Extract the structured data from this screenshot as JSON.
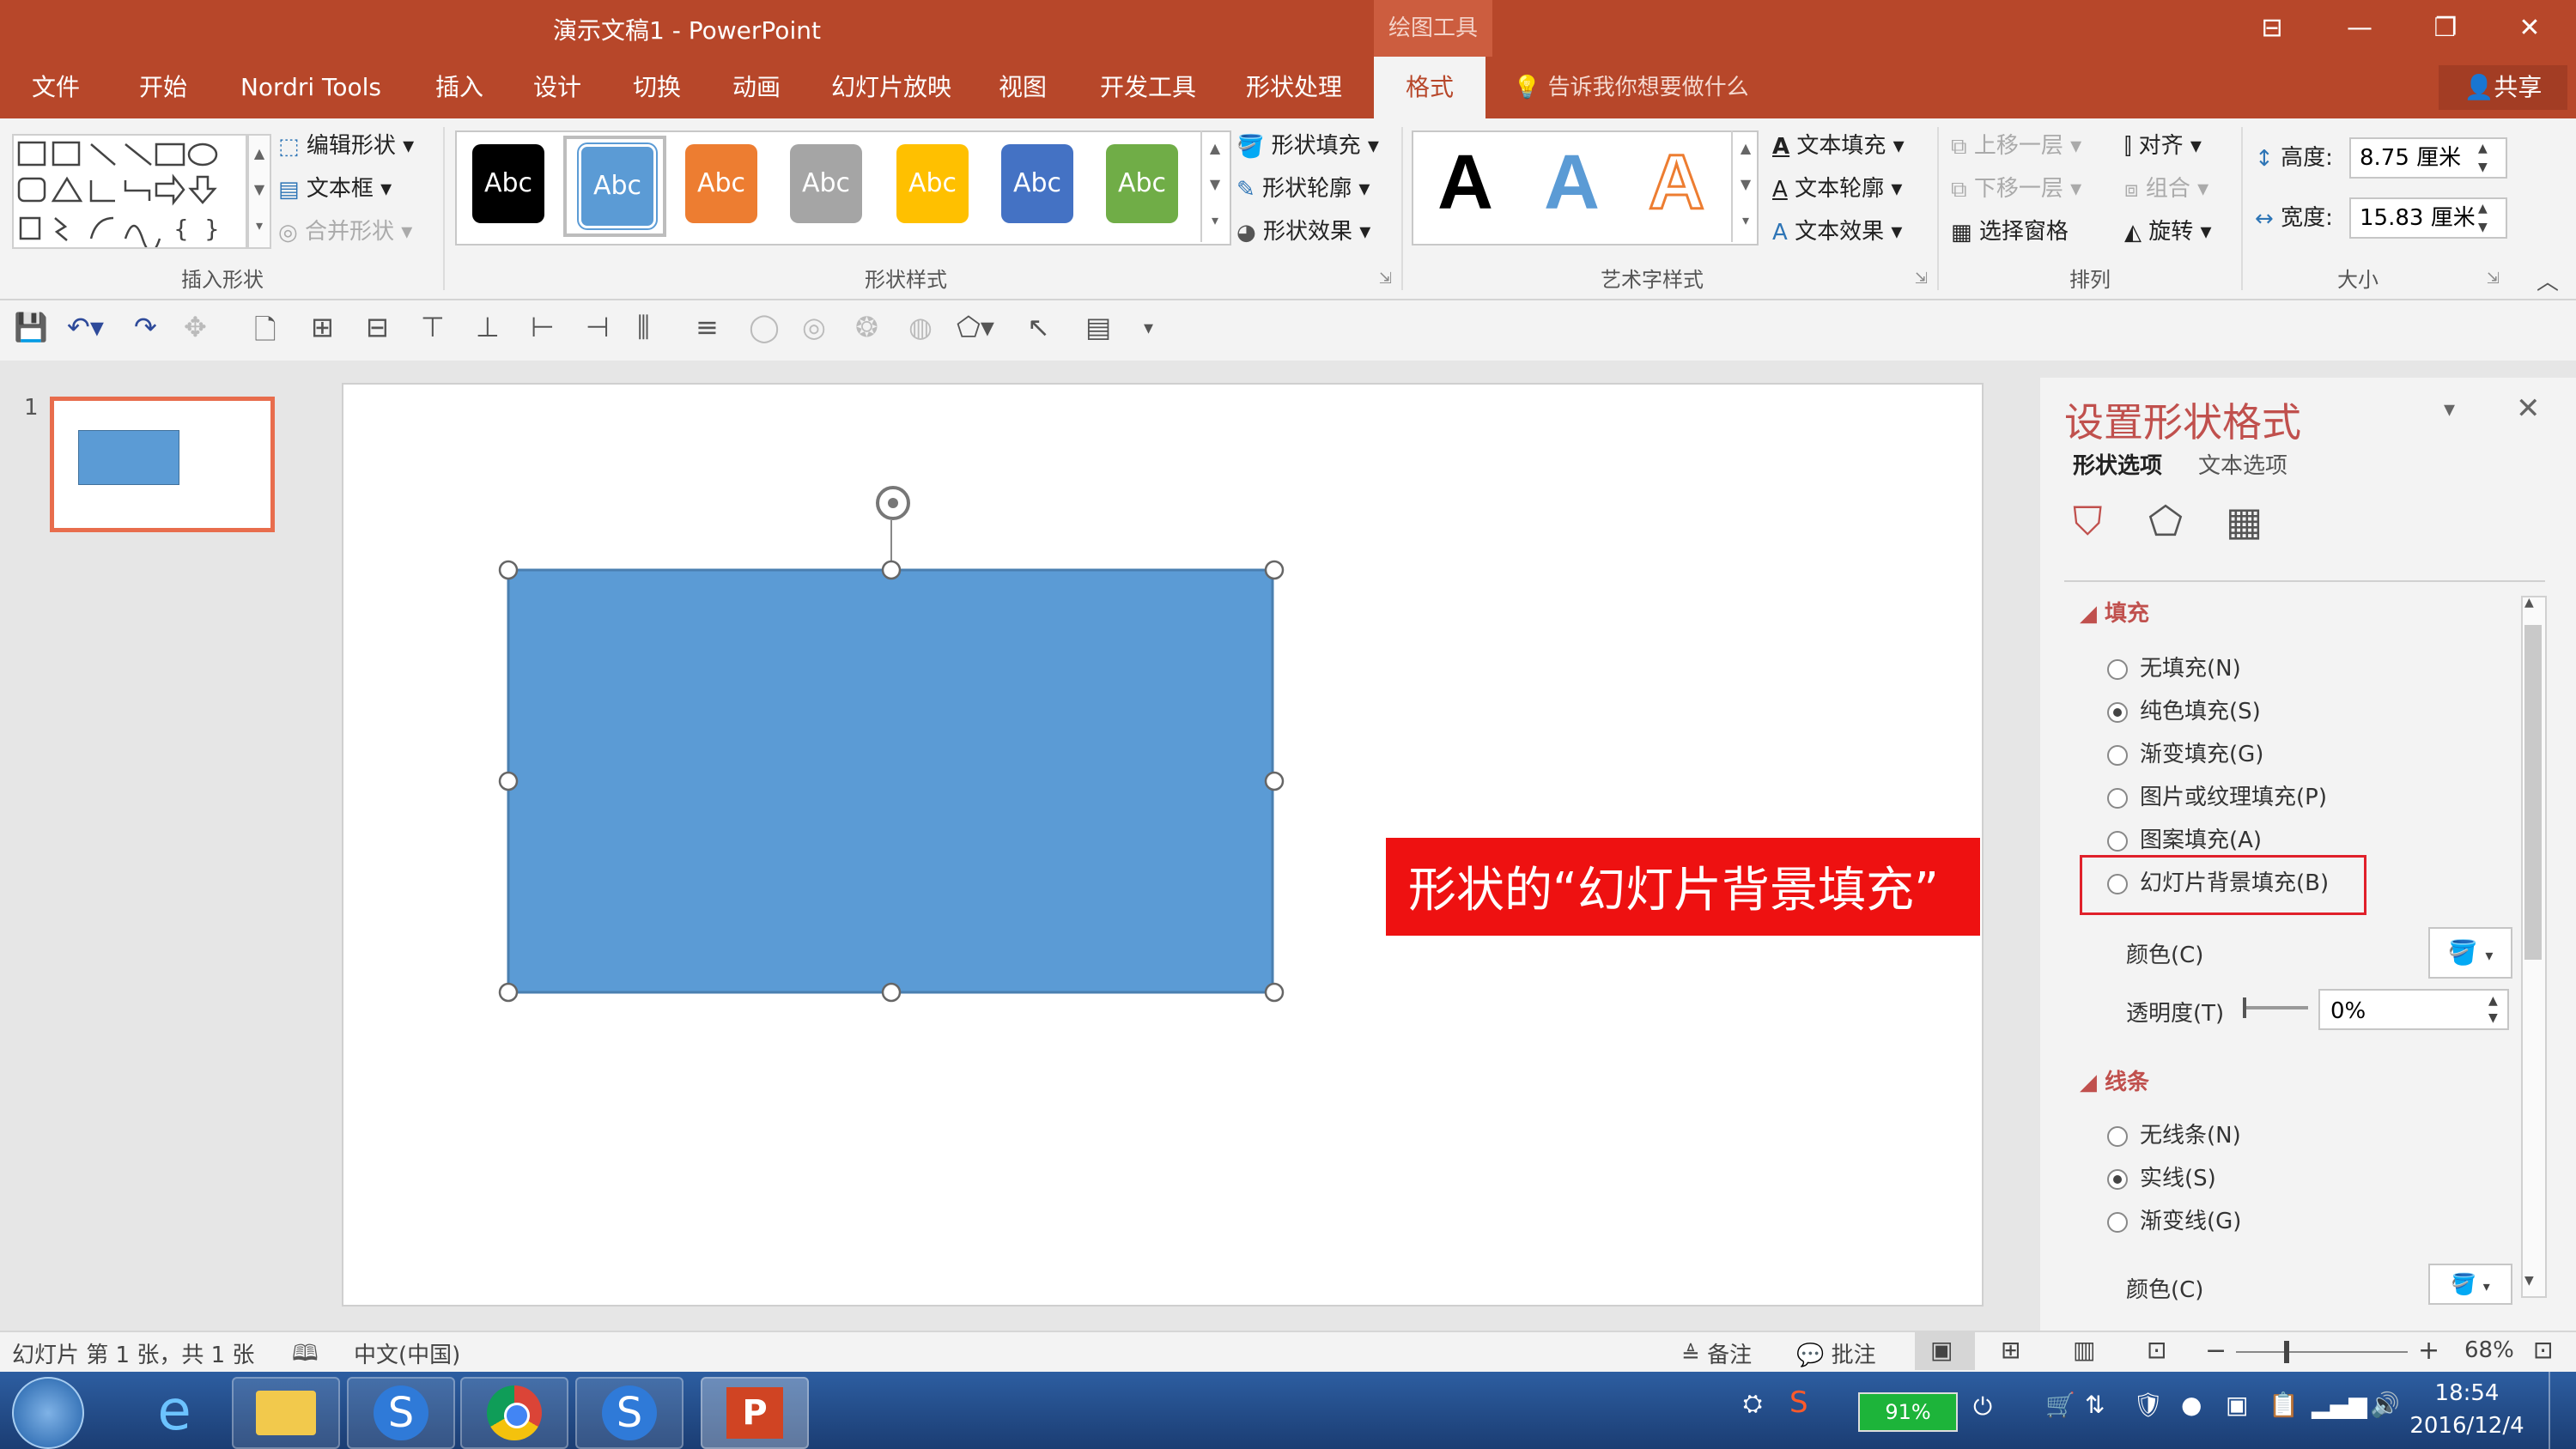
{
  "window": {
    "title": "演示文稿1  -  PowerPoint",
    "context_tab_header": "绘图工具"
  },
  "tabs": [
    "文件",
    "开始",
    "Nordri Tools",
    "插入",
    "设计",
    "切换",
    "动画",
    "幻灯片放映",
    "视图",
    "开发工具",
    "形状处理",
    "格式"
  ],
  "active_tab": "格式",
  "tell_me": "告诉我你想要做什么",
  "share_label": "共享",
  "ribbon": {
    "insert_shapes": {
      "label": "插入形状",
      "edit_shape": "编辑形状",
      "text_box": "文本框",
      "merge_shapes": "合并形状"
    },
    "shape_styles": {
      "label": "形状样式",
      "samples": [
        {
          "text": "Abc",
          "color": "#000000"
        },
        {
          "text": "Abc",
          "color": "#5b9bd5"
        },
        {
          "text": "Abc",
          "color": "#ed7d31"
        },
        {
          "text": "Abc",
          "color": "#a5a5a5"
        },
        {
          "text": "Abc",
          "color": "#ffc000"
        },
        {
          "text": "Abc",
          "color": "#4472c4"
        },
        {
          "text": "Abc",
          "color": "#70ad47"
        }
      ],
      "shape_fill": "形状填充",
      "shape_outline": "形状轮廓",
      "shape_effects": "形状效果"
    },
    "wordart_styles": {
      "label": "艺术字样式",
      "samples": [
        "A",
        "A",
        "A"
      ],
      "text_fill": "文本填充",
      "text_outline": "文本轮廓",
      "text_effects": "文本效果"
    },
    "arrange": {
      "label": "排列",
      "bring_forward": "上移一层",
      "send_backward": "下移一层",
      "selection_pane": "选择窗格",
      "align": "对齐",
      "group": "组合",
      "rotate": "旋转"
    },
    "size": {
      "label": "大小",
      "height_label": "高度:",
      "height_value": "8.75 厘米",
      "width_label": "宽度:",
      "width_value": "15.83 厘米"
    }
  },
  "thumbnail": {
    "number": "1"
  },
  "slide": {
    "shape_color": "#5b9bd5",
    "callout_text": "形状的“幻灯片背景填充”",
    "callout_color": "#ee1111"
  },
  "format_pane": {
    "title": "设置形状格式",
    "tab_shape": "形状选项",
    "tab_text": "文本选项",
    "fill_section": "填充",
    "fill_options": [
      {
        "label": "无填充(N)",
        "checked": false
      },
      {
        "label": "纯色填充(S)",
        "checked": true
      },
      {
        "label": "渐变填充(G)",
        "checked": false
      },
      {
        "label": "图片或纹理填充(P)",
        "checked": false
      },
      {
        "label": "图案填充(A)",
        "checked": false
      },
      {
        "label": "幻灯片背景填充(B)",
        "checked": false
      }
    ],
    "color_label": "颜色(C)",
    "transparency_label": "透明度(T)",
    "transparency_value": "0%",
    "line_section": "线条",
    "line_options": [
      {
        "label": "无线条(N)",
        "checked": false
      },
      {
        "label": "实线(S)",
        "checked": true
      },
      {
        "label": "渐变线(G)",
        "checked": false
      }
    ],
    "line_color_label": "颜色(C)"
  },
  "status": {
    "slide_info": "幻灯片 第 1 张，共 1 张",
    "language": "中文(中国)",
    "notes": "备注",
    "comments": "批注",
    "zoom": "68%"
  },
  "taskbar": {
    "battery": "91%",
    "time": "18:54",
    "date": "2016/12/4"
  }
}
